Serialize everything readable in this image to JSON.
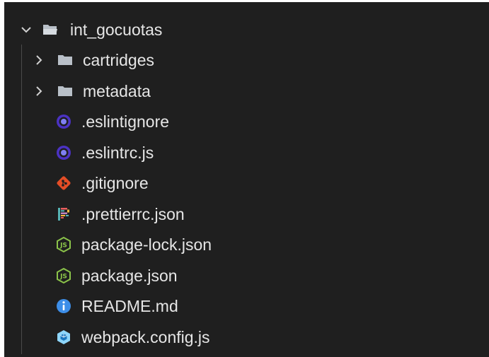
{
  "explorer": {
    "root": {
      "label": "int_gocuotas",
      "expanded": true,
      "icon": "folder-open-icon"
    },
    "items": [
      {
        "label": "cartridges",
        "type": "folder",
        "expanded": false,
        "icon": "folder-icon"
      },
      {
        "label": "metadata",
        "type": "folder",
        "expanded": false,
        "icon": "folder-icon"
      },
      {
        "label": ".eslintignore",
        "type": "file",
        "icon": "eslint-icon"
      },
      {
        "label": ".eslintrc.js",
        "type": "file",
        "icon": "eslint-icon"
      },
      {
        "label": ".gitignore",
        "type": "file",
        "icon": "git-icon"
      },
      {
        "label": ".prettierrc.json",
        "type": "file",
        "icon": "prettier-icon"
      },
      {
        "label": "package-lock.json",
        "type": "file",
        "icon": "nodejs-icon"
      },
      {
        "label": "package.json",
        "type": "file",
        "icon": "nodejs-icon"
      },
      {
        "label": "README.md",
        "type": "file",
        "icon": "info-icon"
      },
      {
        "label": "webpack.config.js",
        "type": "file",
        "icon": "webpack-icon"
      }
    ]
  },
  "colors": {
    "background": "#1f1f1f",
    "text": "#e6e6e6",
    "folder": "#b9c0c8",
    "eslint": "#4b32c3",
    "git": "#e44d26",
    "nodejs": "#8bc34a",
    "info": "#3d8ee8",
    "webpack": "#8ed6fb"
  }
}
